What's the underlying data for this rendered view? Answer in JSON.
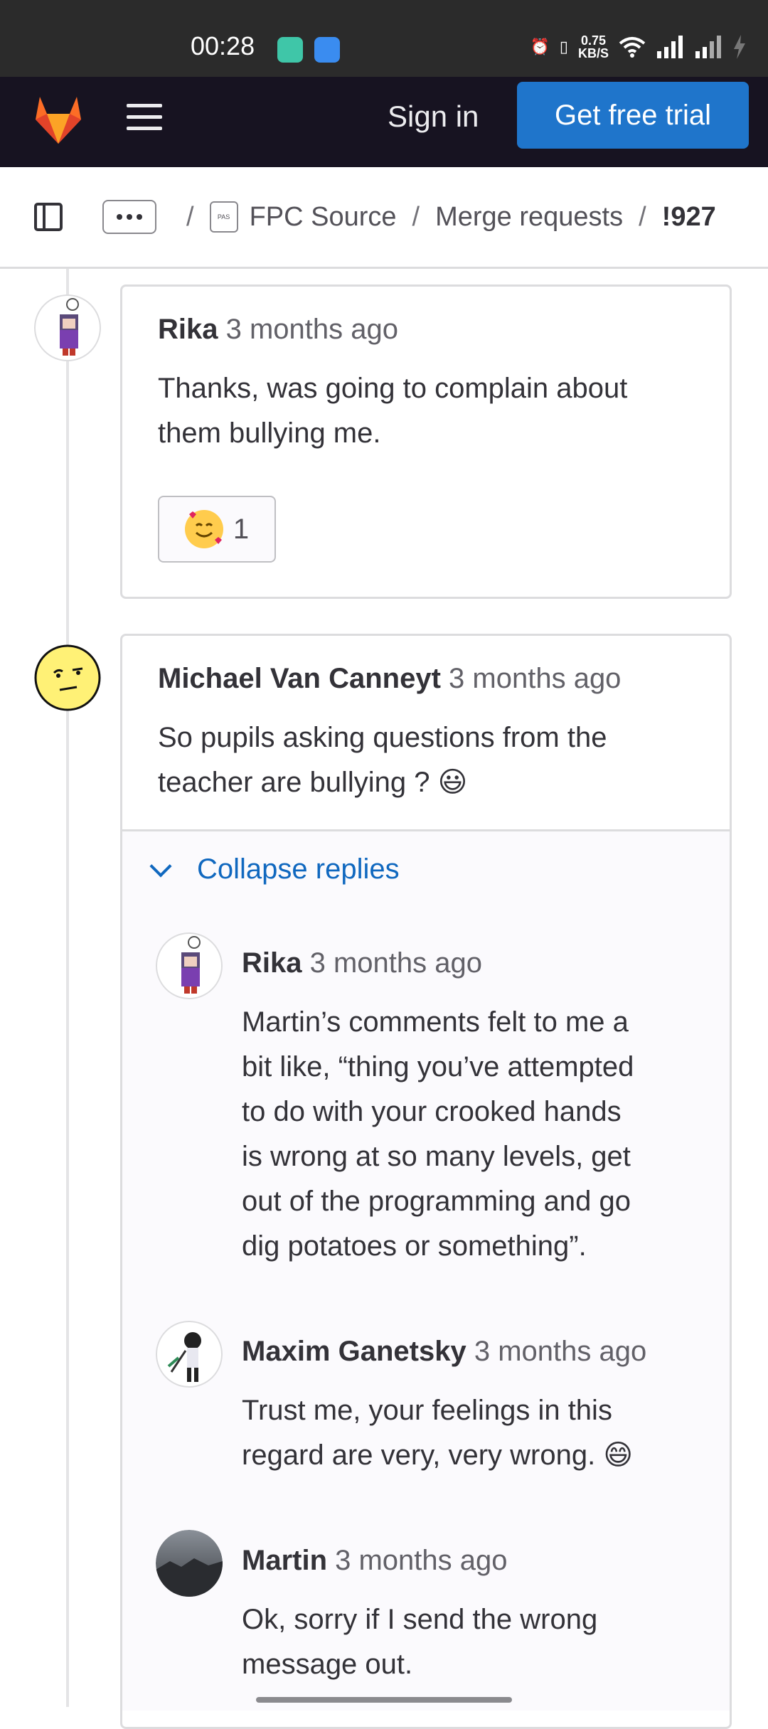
{
  "status_bar": {
    "time": "00:28",
    "net_speed": "0.75",
    "net_unit": "KB/S"
  },
  "topnav": {
    "sign_in": "Sign in",
    "trial": "Get free trial"
  },
  "breadcrumb": {
    "project_icon_text": "PAS",
    "project": "FPC Source",
    "section": "Merge requests",
    "current": "!927"
  },
  "notes": [
    {
      "author": "Rika",
      "time": "3 months ago",
      "body": [
        "Thanks, was going to complain about",
        "them bullying me."
      ],
      "reaction_count": "1"
    },
    {
      "author": "Michael Van Canneyt",
      "time": "3 months ago",
      "body": [
        "So pupils asking questions from the",
        "teacher are bullying ? 😃"
      ]
    }
  ],
  "replies_toggle": "Collapse replies",
  "replies": [
    {
      "author": "Rika",
      "time": "3 months ago",
      "body": [
        "Martin’s comments felt to me a",
        "bit like, “thing you’ve attempted",
        "to do with your crooked hands",
        "is wrong at so many levels, get",
        "out of the programming and go",
        "dig potatoes or something”."
      ]
    },
    {
      "author": "Maxim Ganetsky",
      "time": "3 months ago",
      "body": [
        "Trust me, your feelings in this",
        "regard are very, very wrong. 😄"
      ]
    },
    {
      "author": "Martin",
      "time": "3 months ago",
      "body": [
        "Ok, sorry if I send the wrong",
        "message out."
      ]
    }
  ],
  "colors": {
    "accent": "#1f75cb",
    "nav_bg": "#171321",
    "link": "#1068bf"
  }
}
